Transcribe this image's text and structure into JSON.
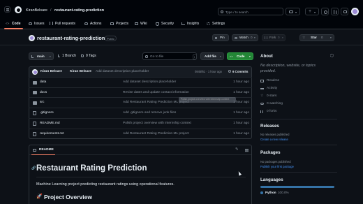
{
  "header": {
    "owner": "KiranBelsare",
    "separator": "/",
    "repo": "restaurant-rating-prediction",
    "search_placeholder": "Type / to search",
    "plus_label": "+"
  },
  "tabs": [
    {
      "label": "Code"
    },
    {
      "label": "Issues"
    },
    {
      "label": "Pull requests"
    },
    {
      "label": "Actions"
    },
    {
      "label": "Projects"
    },
    {
      "label": "Wiki"
    },
    {
      "label": "Security"
    },
    {
      "label": "Insights"
    },
    {
      "label": "Settings"
    }
  ],
  "repo": {
    "title": "restaurant-rating-prediction",
    "visibility": "Public",
    "pin": "Pin",
    "watch": "Watch",
    "watch_count": "0",
    "fork": "Fork",
    "fork_count": "0",
    "star": "Star",
    "star_count": "0"
  },
  "toolbar": {
    "branch": "main",
    "branches": "1 Branch",
    "tags": "0 Tags",
    "goto_placeholder": "Go to file",
    "goto_key": "t",
    "add_file": "Add file",
    "code": "Code"
  },
  "commit": {
    "author1": "Kiran Belsare",
    "author2": "Kiran Belsare",
    "message": "Add dataset description placeholder",
    "hash": "0845f61 · 1 hour ago",
    "commits": "6 Commits"
  },
  "files": [
    {
      "name": "data",
      "type": "folder",
      "message": "Add dataset description placeholder",
      "date": "1 hour ago"
    },
    {
      "name": "docs",
      "type": "folder",
      "message": "Revise dates and update contact information",
      "date": "1 hour ago"
    },
    {
      "name": "src",
      "type": "folder",
      "message": "Add Restaurant Rating Prediction ML project",
      "date": "1 hour ago"
    },
    {
      "name": ".gitignore",
      "type": "file",
      "message": "Add .gitignore and remove junk files",
      "date": "1 hour ago"
    },
    {
      "name": "README.md",
      "type": "file",
      "message": "Polish project overview with internship context",
      "date": "1 hour ago"
    },
    {
      "name": "requirements.txt",
      "type": "file",
      "message": "Add Restaurant Rating Prediction ML project",
      "date": "1 hour ago"
    }
  ],
  "tooltip": "Polish project overview with internship context",
  "readme": {
    "tab": "README",
    "title": "Restaurant Rating Prediction",
    "description": "Machine Learning project predicting restaurant ratings using operational features.",
    "section": "Project Overview",
    "section_emoji": "🚀"
  },
  "about": {
    "title": "About",
    "description": "No description, website, or topics provided.",
    "items": [
      {
        "label": "Readme"
      },
      {
        "label": "Activity"
      },
      {
        "label": "0 stars"
      },
      {
        "label": "0 watching"
      },
      {
        "label": "0 forks"
      }
    ]
  },
  "releases": {
    "title": "Releases",
    "none": "No releases published",
    "link": "Create a new release"
  },
  "packages": {
    "title": "Packages",
    "none": "No packages published",
    "link": "Publish your first package"
  },
  "languages": {
    "title": "Languages",
    "items": [
      {
        "name": "Python",
        "percent": "100.0%",
        "color": "#3572A5"
      }
    ]
  },
  "colors": {
    "accent": "#4493f8",
    "green": "#238636",
    "underline": "#f78166"
  }
}
